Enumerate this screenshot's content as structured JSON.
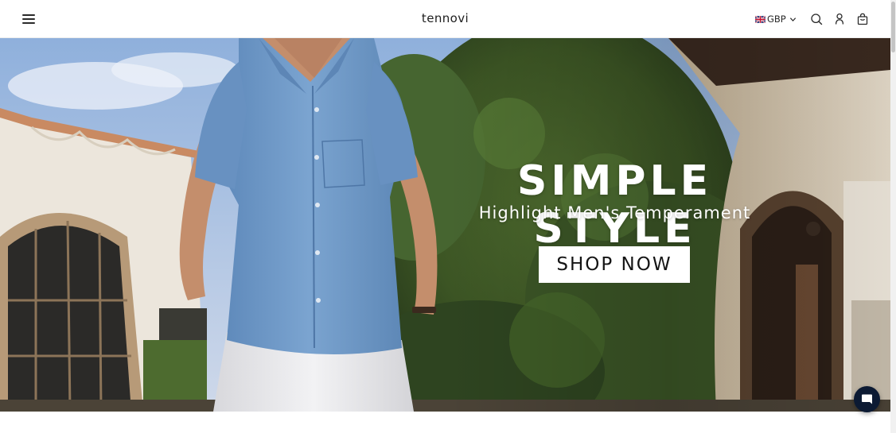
{
  "header": {
    "logo": "tennovi",
    "currency": {
      "code": "GBP",
      "flag": "uk-flag-icon"
    },
    "icons": [
      "menu-icon",
      "search-icon",
      "account-icon",
      "cart-icon"
    ]
  },
  "hero": {
    "title": "SIMPLE STYLE",
    "subtitle": "Highlight Men's Temperament",
    "button_label": "SHOP NOW"
  },
  "chat": {
    "icon": "chat-icon"
  },
  "colors": {
    "header_bg": "#ffffff",
    "button_bg": "#ffffff",
    "chat_bg": "#0c1a33",
    "shirt_blue": "#6f98c6"
  }
}
